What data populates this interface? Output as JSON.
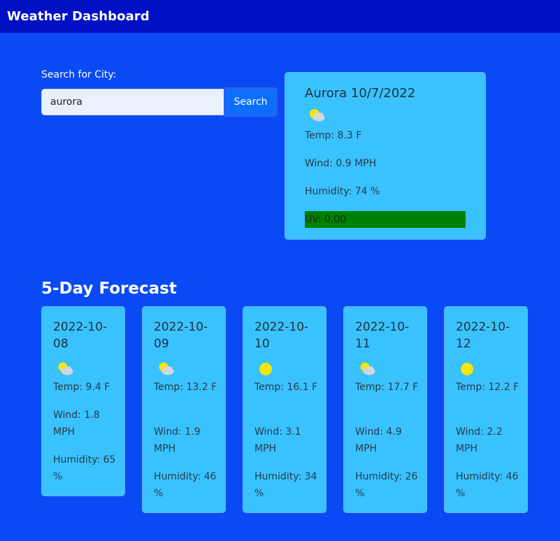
{
  "navbar": {
    "title": "Weather Dashboard"
  },
  "search": {
    "label": "Search for City:",
    "value": "aurora",
    "button_label": "Search"
  },
  "current": {
    "title": "Aurora 10/7/2022",
    "icon": "partly-cloudy-icon",
    "temp": "Temp: 8.3 F",
    "wind": "Wind: 0.9 MPH",
    "humidity": "Humidity: 74 %",
    "uv": "UV: 0.00",
    "uv_color": "#008000"
  },
  "forecast": {
    "heading": "5-Day Forecast",
    "days": [
      {
        "date": "2022-10-08",
        "icon": "partly-cloudy-icon",
        "temp": "Temp: 9.4 F",
        "wind": "Wind: 1.8 MPH",
        "humidity": "Humidity: 65 %"
      },
      {
        "date": "2022-10-09",
        "icon": "partly-cloudy-icon",
        "temp": "Temp: 13.2 F",
        "wind": "Wind: 1.9 MPH",
        "humidity": "Humidity: 46 %"
      },
      {
        "date": "2022-10-10",
        "icon": "sun-icon",
        "temp": "Temp: 16.1 F",
        "wind": "Wind: 3.1 MPH",
        "humidity": "Humidity: 34 %"
      },
      {
        "date": "2022-10-11",
        "icon": "partly-cloudy-icon",
        "temp": "Temp: 17.7 F",
        "wind": "Wind: 4.9 MPH",
        "humidity": "Humidity: 26 %"
      },
      {
        "date": "2022-10-12",
        "icon": "sun-icon",
        "temp": "Temp: 12.2 F",
        "wind": "Wind: 2.2 MPH",
        "humidity": "Humidity: 46 %"
      }
    ]
  },
  "colors": {
    "page_background": "#0a4af5",
    "navbar": "#0011c4",
    "card": "#39c2fd",
    "button": "#0d6efd",
    "sun": "#f5e60a"
  }
}
